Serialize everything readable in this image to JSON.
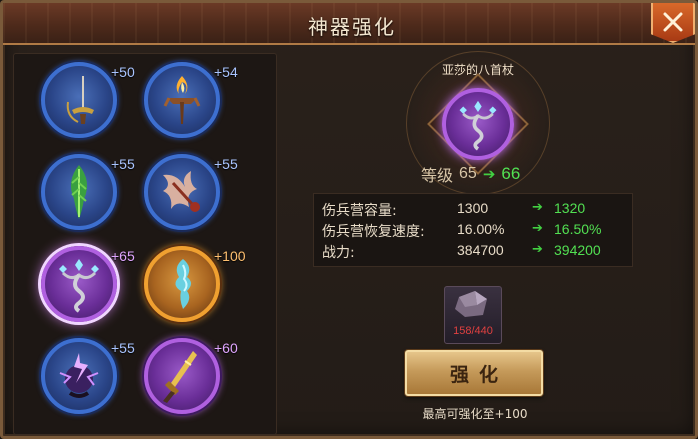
{
  "window": {
    "title": "神器强化"
  },
  "artifacts": [
    {
      "level": "+50",
      "rarity": "blue",
      "icon": "sword-icon"
    },
    {
      "level": "+54",
      "rarity": "blue",
      "icon": "flame-torch-icon"
    },
    {
      "level": "+55",
      "rarity": "blue",
      "icon": "green-feather-icon"
    },
    {
      "level": "+55",
      "rarity": "blue",
      "icon": "bone-feather-icon"
    },
    {
      "level": "+65",
      "rarity": "purple",
      "icon": "staff-icon",
      "selected": true
    },
    {
      "level": "+100",
      "rarity": "orange",
      "icon": "ice-spirit-icon"
    },
    {
      "level": "+55",
      "rarity": "blue",
      "icon": "lightning-orb-icon"
    },
    {
      "level": "+60",
      "rarity": "purple",
      "icon": "gold-dagger-icon"
    }
  ],
  "selected": {
    "name": "亚莎的八首杖",
    "level_label": "等级",
    "level_current": "65",
    "level_next": "66"
  },
  "stats": [
    {
      "label": "伤兵营容量:",
      "current": "1300",
      "next": "1320"
    },
    {
      "label": "伤兵营恢复速度:",
      "current": "16.00%",
      "next": "16.50%"
    },
    {
      "label": "战力:",
      "current": "384700",
      "next": "394200"
    }
  ],
  "material": {
    "count": "158/440",
    "count_color": "#e04040"
  },
  "actions": {
    "enhance_label": "强化"
  },
  "footer": {
    "max_note": "最高可强化至+100"
  },
  "colors": {
    "blue_ring": "#3d6fd0",
    "purple_ring": "#b060e0",
    "orange_ring": "#f0a030",
    "increase_green": "#52e052"
  }
}
